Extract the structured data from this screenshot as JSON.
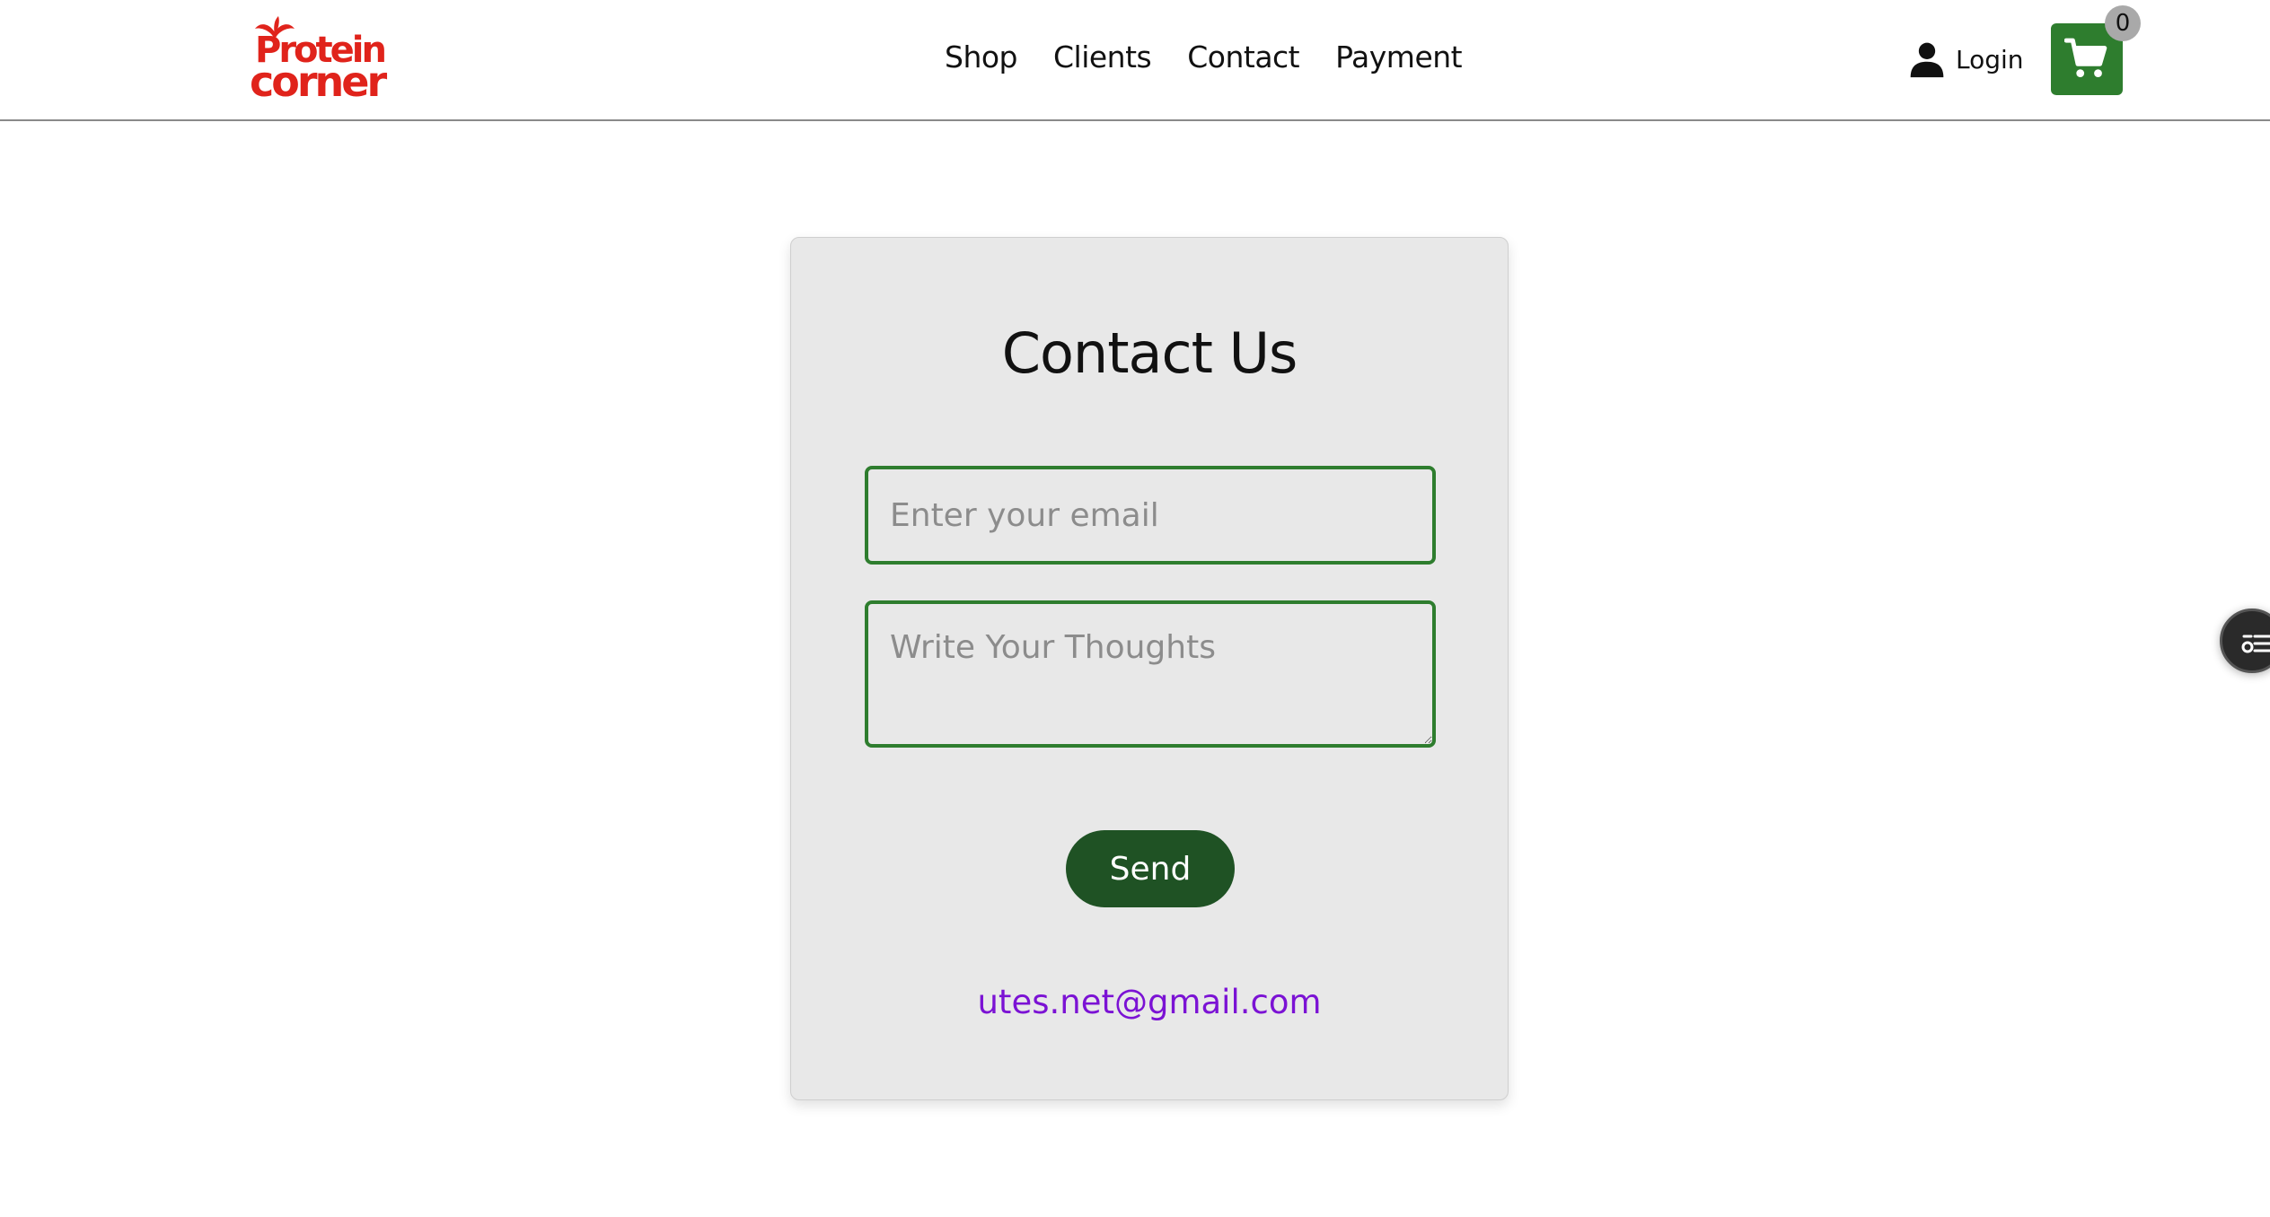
{
  "brand": {
    "logo_line1": "Protein",
    "logo_line2": "corner"
  },
  "nav": {
    "items": [
      {
        "label": "Shop"
      },
      {
        "label": "Clients"
      },
      {
        "label": "Contact"
      },
      {
        "label": "Payment"
      }
    ]
  },
  "account": {
    "login_label": "Login",
    "icon": "user-icon"
  },
  "cart": {
    "count": "0",
    "icon": "cart-icon"
  },
  "contact_form": {
    "title": "Contact Us",
    "email_placeholder": "Enter your email",
    "thoughts_placeholder": "Write Your Thoughts",
    "send_label": "Send",
    "contact_email": "utes.net@gmail.com"
  },
  "colors": {
    "brand_red": "#e0231b",
    "accent_green": "#2e7d2e",
    "button_green": "#1f5224",
    "link_purple": "#7b12d4",
    "card_bg": "#e8e8e8"
  }
}
